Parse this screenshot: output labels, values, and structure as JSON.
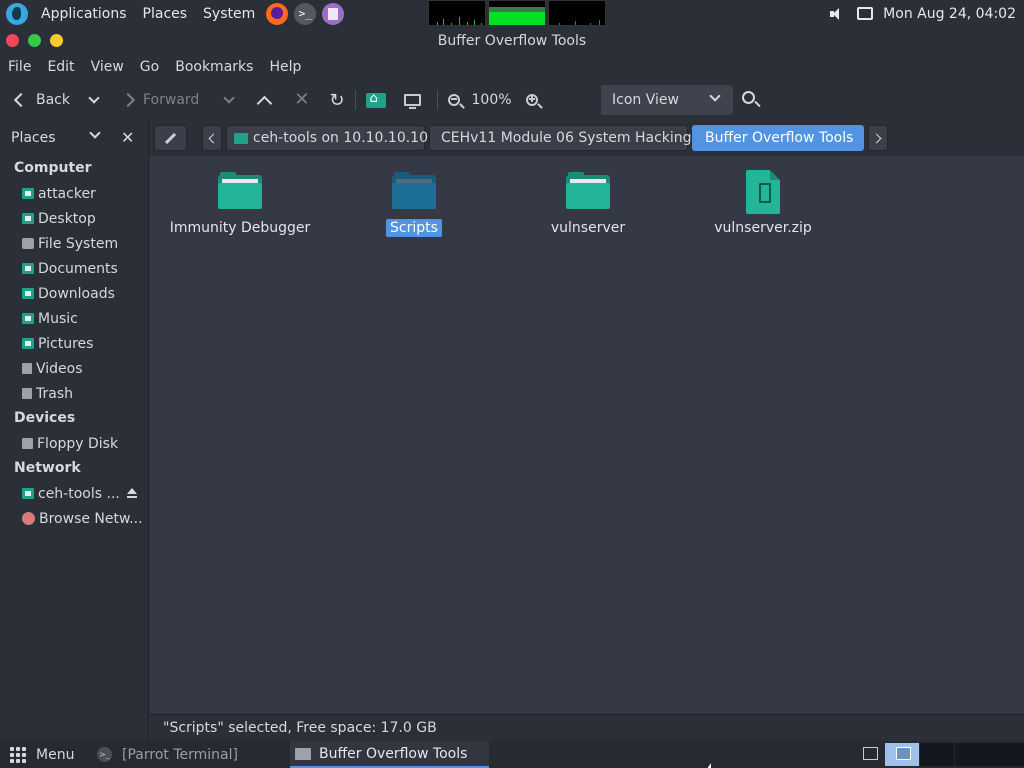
{
  "top_panel": {
    "menus": [
      "Applications",
      "Places",
      "System"
    ],
    "launchers": [
      "parrot-logo-icon",
      "firefox-icon",
      "terminal-icon",
      "text-editor-icon"
    ],
    "clock": "Mon Aug 24, 04:02",
    "terminal_glyph": ">_"
  },
  "window": {
    "title": "Buffer Overflow Tools",
    "colors": {
      "close": "#f2475b",
      "maximize": "#35cb4a",
      "minimize": "#f7cc2c",
      "accent": "#5294e2",
      "folder": "#22b597"
    }
  },
  "menubar": [
    "File",
    "Edit",
    "View",
    "Go",
    "Bookmarks",
    "Help"
  ],
  "toolbar": {
    "back": "Back",
    "forward": "Forward",
    "zoom": "100%",
    "view_mode": "Icon View"
  },
  "sidebar": {
    "header": "Places",
    "sections": [
      {
        "title": "Computer",
        "items": [
          {
            "label": "attacker",
            "icon": "home-folder-icon"
          },
          {
            "label": "Desktop",
            "icon": "desktop-icon"
          },
          {
            "label": "File System",
            "icon": "drive-icon"
          },
          {
            "label": "Documents",
            "icon": "documents-folder-icon"
          },
          {
            "label": "Downloads",
            "icon": "downloads-folder-icon"
          },
          {
            "label": "Music",
            "icon": "music-folder-icon"
          },
          {
            "label": "Pictures",
            "icon": "pictures-folder-icon"
          },
          {
            "label": "Videos",
            "icon": "videos-icon"
          },
          {
            "label": "Trash",
            "icon": "trash-icon"
          }
        ]
      },
      {
        "title": "Devices",
        "items": [
          {
            "label": "Floppy Disk",
            "icon": "floppy-icon"
          }
        ]
      },
      {
        "title": "Network",
        "items": [
          {
            "label": "ceh-tools ...",
            "icon": "network-share-icon"
          },
          {
            "label": "Browse Netw...",
            "icon": "network-icon"
          }
        ]
      }
    ]
  },
  "pathbar": {
    "crumbs": [
      "ceh-tools on 10.10.10.10",
      "CEHv11 Module 06 System Hacking",
      "Buffer Overflow Tools"
    ],
    "active_index": 2
  },
  "files": [
    {
      "name": "Immunity Debugger",
      "type": "folder",
      "selected": false
    },
    {
      "name": "Scripts",
      "type": "folder",
      "selected": true
    },
    {
      "name": "vulnserver",
      "type": "folder",
      "selected": false
    },
    {
      "name": "vulnserver.zip",
      "type": "zip",
      "selected": false
    }
  ],
  "status": "\"Scripts\" selected, Free space: 17.0 GB",
  "bottom_panel": {
    "menu": "Menu",
    "tasks": [
      "[Parrot Terminal]",
      "Buffer Overflow Tools"
    ],
    "active_task": 1
  }
}
